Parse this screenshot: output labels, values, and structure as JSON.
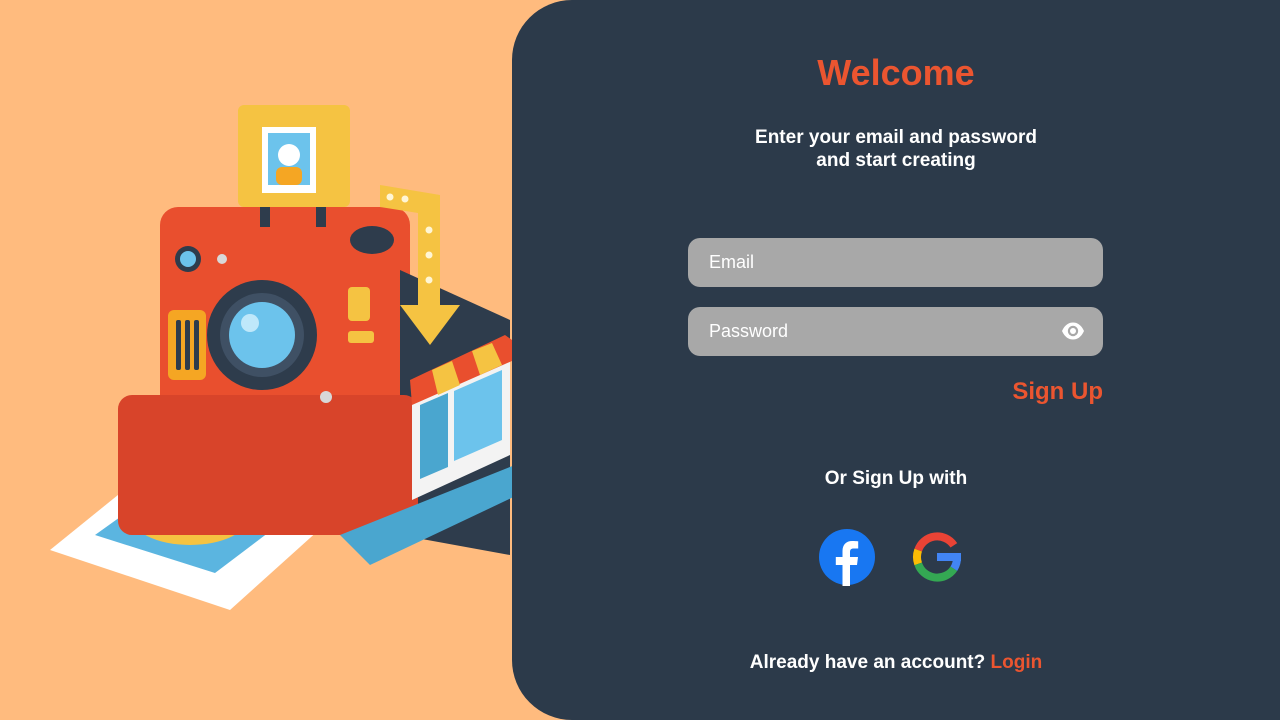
{
  "colors": {
    "background_left": "#ffbb7e",
    "panel": "#2c3a4a",
    "accent": "#eb5530",
    "input_bg": "#a8a8a8",
    "text": "#ffffff"
  },
  "header": {
    "title": "Welcome",
    "subtitle_line1": "Enter your email and password",
    "subtitle_line2": "and start creating"
  },
  "form": {
    "email_placeholder": "Email",
    "email_value": "",
    "password_placeholder": "Password",
    "password_value": "",
    "password_toggle_icon": "eye-icon",
    "signup_label": "Sign Up"
  },
  "social": {
    "label": "Or Sign Up with",
    "providers": [
      {
        "name": "facebook",
        "icon": "facebook-icon"
      },
      {
        "name": "google",
        "icon": "google-icon"
      }
    ]
  },
  "footer": {
    "question": "Already have an account?",
    "login_label": "Login"
  },
  "illustration": {
    "icon": "instant-camera-illustration"
  }
}
